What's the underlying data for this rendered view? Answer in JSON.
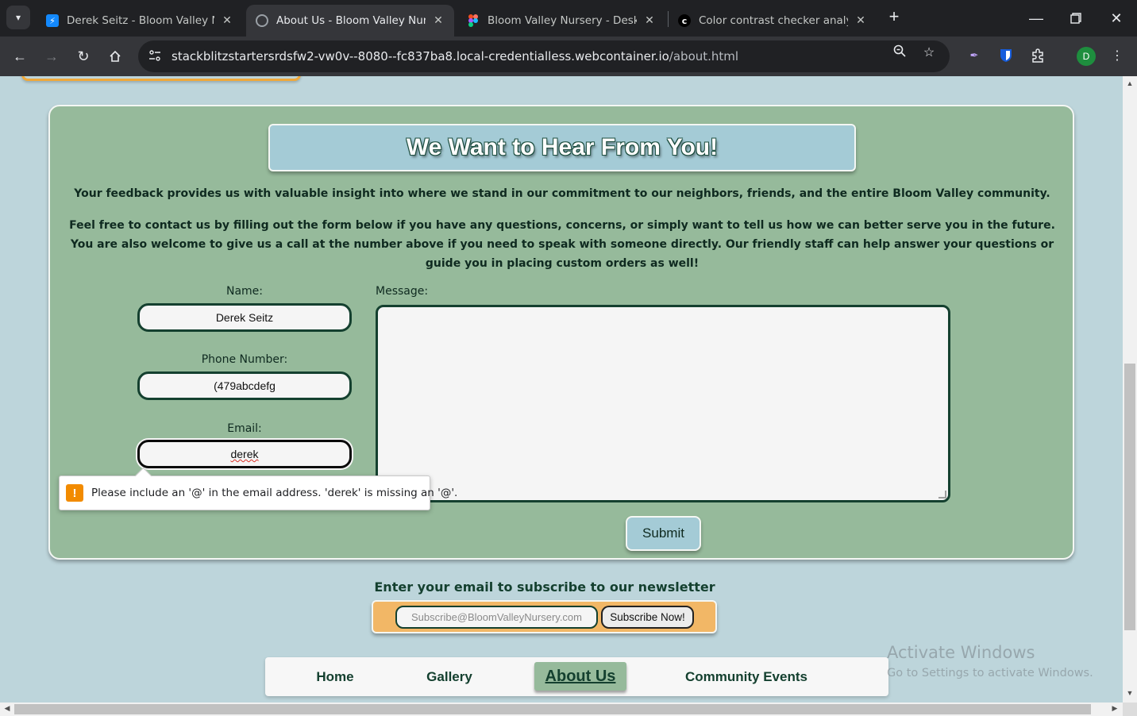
{
  "browser": {
    "tabs": [
      {
        "title": "Derek Seitz - Bloom Valley Nurs",
        "icon": "stackblitz-icon",
        "active": false
      },
      {
        "title": "About Us - Bloom Valley Nurser",
        "icon": "globe-icon",
        "active": true
      },
      {
        "title": "Bloom Valley Nursery - Desktop",
        "icon": "figma-icon",
        "active": false
      },
      {
        "title": "Color contrast checker analyzer",
        "icon": "contrast-checker-icon",
        "active": false
      }
    ],
    "tab_close": "✕",
    "new_tab": "+",
    "url_domain": "stackblitzstartersrdsfw2-vw0v--8080--fc837ba8.local-credentialless.webcontainer.io",
    "url_path": "/about.html",
    "profile_initial": "D"
  },
  "contact": {
    "heading": "We Want to Hear From You!",
    "intro": "Your feedback provides us with valuable insight into where we stand in our commitment to our neighbors, friends, and the entire Bloom Valley community.",
    "instructions": "Feel free to contact us by filling out the form below if you have any questions, concerns, or simply want to tell us how we can better serve you in the future. You are also welcome to give us a call at the number above if you need to speak with someone directly. Our friendly staff can help answer your questions or guide you in placing custom orders as well!",
    "name_label": "Name:",
    "name_value": "Derek Seitz",
    "phone_label": "Phone Number:",
    "phone_value": "(479abcdefg",
    "email_label": "Email:",
    "email_value": "derek",
    "message_label": "Message:",
    "message_value": "",
    "submit_label": "Submit",
    "validation_message": "Please include an '@' in the email address. 'derek' is missing an '@'."
  },
  "newsletter": {
    "title": "Enter your email to subscribe to our newsletter",
    "placeholder": "Subscribe@BloomValleyNursery.com",
    "button_label": "Subscribe Now!"
  },
  "footer_nav": {
    "items": [
      {
        "label": "Home",
        "current": false
      },
      {
        "label": "Gallery",
        "current": false
      },
      {
        "label": "About Us",
        "current": true
      },
      {
        "label": "Community Events",
        "current": false
      }
    ]
  },
  "watermark": {
    "line1": "Activate Windows",
    "line2": "Go to Settings to activate Windows."
  },
  "colors": {
    "panel": "#96ba9b",
    "heading_bg": "#a4cbd6",
    "page_bg": "#bdd5db",
    "newsletter_bg": "#f2b766",
    "text_dark": "#14402f"
  }
}
